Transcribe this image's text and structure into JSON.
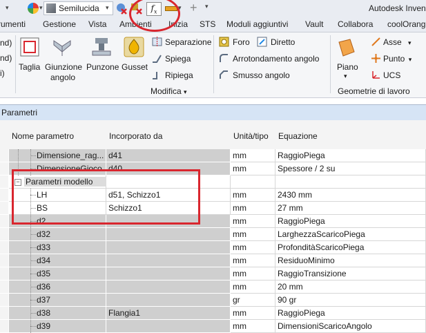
{
  "qat": {
    "material": "Semilucida",
    "fx_label": "f",
    "fx_sub": "x",
    "app_title": "Autodesk Invent"
  },
  "tabs": [
    "rumenti",
    "Gestione",
    "Vista",
    "Ambienti",
    "Inizia",
    "STS",
    "Moduli aggiuntivi",
    "Vault",
    "Collabora",
    "coolOrang"
  ],
  "ribbon": {
    "left_partial_1": "nd)",
    "left_partial_2": "nd)",
    "left_partial_3": "i)",
    "taglia": "Taglia",
    "giunzione_1": "Giunzione",
    "giunzione_2": "angolo",
    "punzone": "Punzone",
    "gusset": "Gusset",
    "separazione": "Separazione",
    "spiega": "Spiega",
    "ripiega": "Ripiega",
    "modifica": "Modifica",
    "foro": "Foro",
    "diretto": "Diretto",
    "arrotondamento": "Arrotondamento angolo",
    "smusso": "Smusso angolo",
    "piano": "Piano",
    "asse": "Asse",
    "punto": "Punto",
    "ucs": "UCS",
    "geometrie": "Geometrie di lavoro"
  },
  "dialog": {
    "title": "Parametri"
  },
  "table": {
    "columns": [
      "Nome parametro",
      "Incorporato da",
      "Unità/tipo",
      "Equazione"
    ],
    "rows": [
      {
        "name": "Dimensione_rag...",
        "by": "d41",
        "unit": "mm",
        "eq": "RaggioPiega",
        "white": false
      },
      {
        "name": "DimensioneGioco",
        "by": "d40",
        "unit": "mm",
        "eq": "Spessore / 2 su",
        "white": false
      },
      {
        "name": "Parametri modello",
        "by": "",
        "unit": "",
        "eq": "",
        "white": false,
        "group": true
      },
      {
        "name": "LH",
        "by": "d51, Schizzo1",
        "unit": "mm",
        "eq": "2430 mm",
        "white": true
      },
      {
        "name": "BS",
        "by": "Schizzo1",
        "unit": "mm",
        "eq": "27 mm",
        "white": true
      },
      {
        "name": "d2",
        "by": "",
        "unit": "mm",
        "eq": "RaggioPiega",
        "white": false
      },
      {
        "name": "d32",
        "by": "",
        "unit": "mm",
        "eq": "LarghezzaScaricoPiega",
        "white": false
      },
      {
        "name": "d33",
        "by": "",
        "unit": "mm",
        "eq": "ProfonditàScaricoPiega",
        "white": false
      },
      {
        "name": "d34",
        "by": "",
        "unit": "mm",
        "eq": "ResiduoMinimo",
        "white": false
      },
      {
        "name": "d35",
        "by": "",
        "unit": "mm",
        "eq": "RaggioTransizione",
        "white": false
      },
      {
        "name": "d36",
        "by": "",
        "unit": "mm",
        "eq": "20 mm",
        "white": false
      },
      {
        "name": "d37",
        "by": "",
        "unit": "gr",
        "eq": "90 gr",
        "white": false
      },
      {
        "name": "d38",
        "by": "Flangia1",
        "unit": "mm",
        "eq": "RaggioPiega",
        "white": false
      },
      {
        "name": "d39",
        "by": "",
        "unit": "mm",
        "eq": "DimensioniScaricoAngolo",
        "white": false
      }
    ]
  }
}
